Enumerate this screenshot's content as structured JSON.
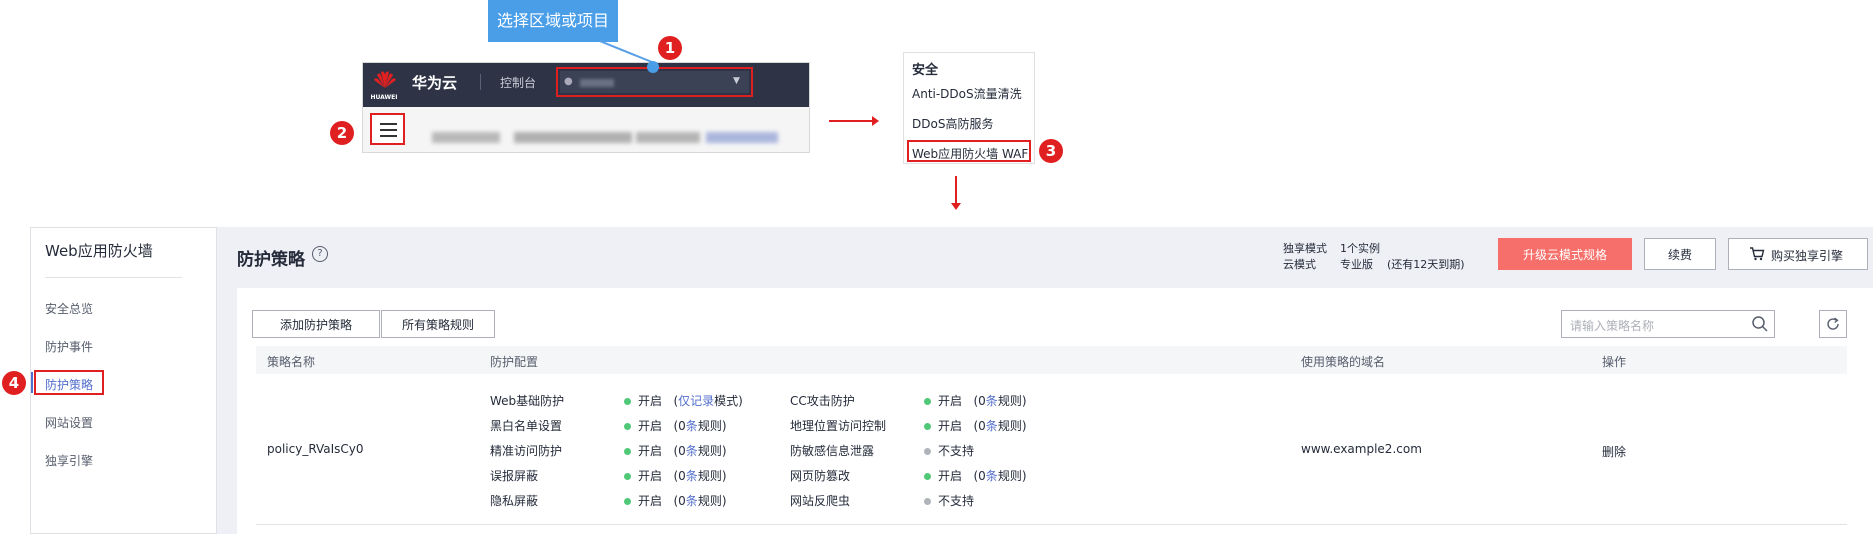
{
  "tutorial": {
    "tooltip": "选择区域或项目",
    "steps": [
      "1",
      "2",
      "3",
      "4"
    ],
    "header": {
      "logo_text": "HUAWEI",
      "brand": "华为云",
      "console": "控制台",
      "region_icon": "location-pin-icon",
      "caret_icon": "caret-down-icon"
    },
    "menu": {
      "title": "安全",
      "items": [
        "Anti-DDoS流量清洗",
        "DDoS高防服务",
        "Web应用防火墙 WAF"
      ]
    }
  },
  "sidebar": {
    "title": "Web应用防火墙",
    "items": [
      "安全总览",
      "防护事件",
      "防护策略",
      "网站设置",
      "独享引擎"
    ],
    "active_index": 2
  },
  "header": {
    "title": "防护策略",
    "help_icon": "?",
    "mode_dedicated_label": "独享模式",
    "mode_dedicated_value": "1个实例",
    "mode_cloud_label": "云模式",
    "mode_cloud_value": "专业版",
    "mode_cloud_expiry": "(还有12天到期)",
    "upgrade_button": "升级云模式规格",
    "renew_button": "续费",
    "buy_button": "购买独享引擎",
    "buy_icon": "cart-icon"
  },
  "toolbar": {
    "add_button": "添加防护策略",
    "all_rules_button": "所有策略规则",
    "search_placeholder": "请输入策略名称",
    "search_icon": "search-icon",
    "refresh_icon": "refresh-icon"
  },
  "table": {
    "columns": [
      "策略名称",
      "防护配置",
      "使用策略的域名",
      "操作"
    ],
    "row": {
      "name": "policy_RVaIsCy0",
      "domain": "www.example2.com",
      "action": "删除",
      "config_left": [
        {
          "name": "Web基础防护",
          "status": "开启",
          "pre": "(",
          "link": "仅记录",
          "post": "模式)",
          "on": true
        },
        {
          "name": "黑白名单设置",
          "status": "开启",
          "pre": "(0",
          "link": "条",
          "post": "规则)",
          "on": true
        },
        {
          "name": "精准访问防护",
          "status": "开启",
          "pre": "(0",
          "link": "条",
          "post": "规则)",
          "on": true
        },
        {
          "name": "误报屏蔽",
          "status": "开启",
          "pre": "(0",
          "link": "条",
          "post": "规则)",
          "on": true
        },
        {
          "name": "隐私屏蔽",
          "status": "开启",
          "pre": "(0",
          "link": "条",
          "post": "规则)",
          "on": true
        }
      ],
      "config_right": [
        {
          "name": "CC攻击防护",
          "status": "开启",
          "pre": "(0",
          "link": "条",
          "post": "规则)",
          "on": true
        },
        {
          "name": "地理位置访问控制",
          "status": "开启",
          "pre": "(0",
          "link": "条",
          "post": "规则)",
          "on": true
        },
        {
          "name": "防敏感信息泄露",
          "status": "不支持",
          "pre": "",
          "link": "",
          "post": "",
          "on": false
        },
        {
          "name": "网页防篡改",
          "status": "开启",
          "pre": "(0",
          "link": "条",
          "post": "规则)",
          "on": true
        },
        {
          "name": "网站反爬虫",
          "status": "不支持",
          "pre": "",
          "link": "",
          "post": "",
          "on": false
        }
      ]
    }
  },
  "colors": {
    "accent": "#526ecc",
    "danger": "#e02020",
    "upgrade": "#f66f6a",
    "status_on": "#50c878",
    "status_off": "#b0b3ba",
    "tooltip": "#4a9ee8"
  }
}
